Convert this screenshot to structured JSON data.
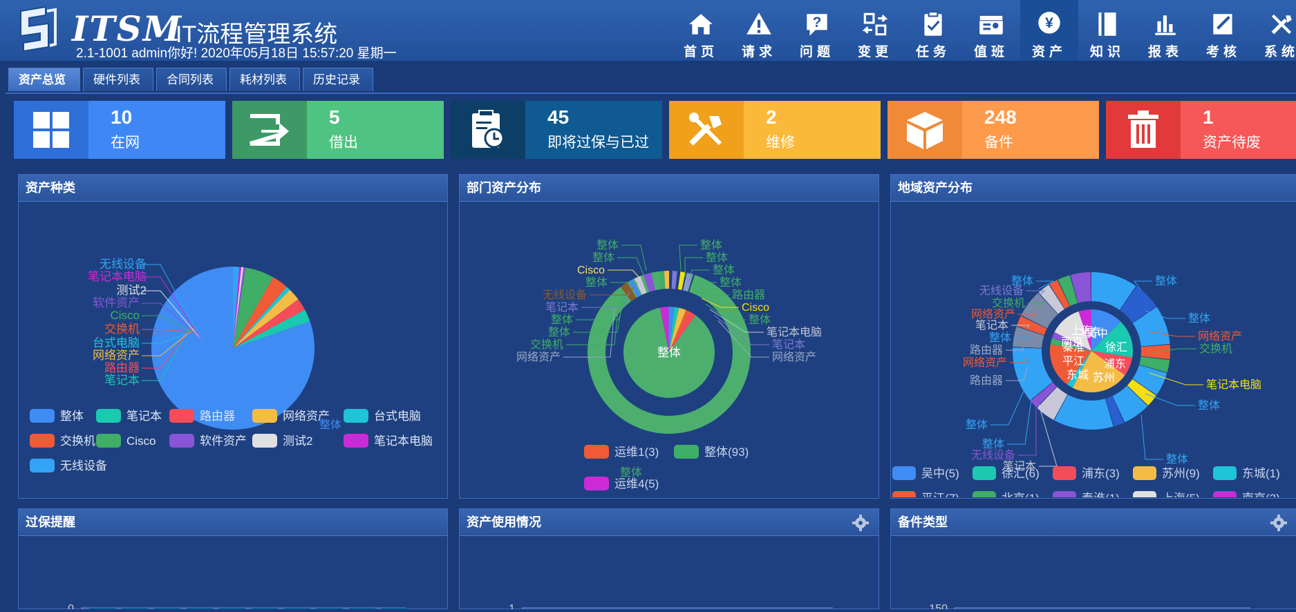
{
  "header": {
    "logo_text": "ITSM",
    "system_title": "IT流程管理系统",
    "user_info": "2.1-1001 admin你好!  2020年05月18日 15:57:20 星期一"
  },
  "nav": [
    {
      "label": "首页",
      "icon": "home-icon"
    },
    {
      "label": "请求",
      "icon": "warning-icon"
    },
    {
      "label": "问题",
      "icon": "question-icon"
    },
    {
      "label": "变更",
      "icon": "swap-icon"
    },
    {
      "label": "任务",
      "icon": "task-icon"
    },
    {
      "label": "值班",
      "icon": "duty-icon"
    },
    {
      "label": "资产",
      "icon": "yen-icon",
      "active": true
    },
    {
      "label": "知识",
      "icon": "book-icon"
    },
    {
      "label": "报表",
      "icon": "chart-icon"
    },
    {
      "label": "考核",
      "icon": "edit-icon"
    },
    {
      "label": "系统",
      "icon": "tools-icon"
    }
  ],
  "tabs": [
    "资产总览",
    "硬件列表",
    "合同列表",
    "耗材列表",
    "历史记录"
  ],
  "stats": [
    {
      "value": "10",
      "label": "在网",
      "icon": "grid-icon",
      "icon_bg": "#2f6fd8",
      "bg": "#3f87f5"
    },
    {
      "value": "5",
      "label": "借出",
      "icon": "export-icon",
      "icon_bg": "#3d9a66",
      "bg": "#4fc381"
    },
    {
      "value": "45",
      "label": "即将过保与已过",
      "icon": "clipboard-clock-icon",
      "icon_bg": "#0d3f66",
      "bg": "#0f5a92"
    },
    {
      "value": "2",
      "label": "维修",
      "icon": "tools-icon",
      "icon_bg": "#f0a01a",
      "bg": "#fbb93a"
    },
    {
      "value": "248",
      "label": "备件",
      "icon": "box-icon",
      "icon_bg": "#f08a36",
      "bg": "#fd9a4c"
    },
    {
      "value": "1",
      "label": "资产待废",
      "icon": "trash-icon",
      "icon_bg": "#e23a3a",
      "bg": "#f65757"
    }
  ],
  "panels": {
    "asset_types": "资产种类",
    "dept_dist": "部门资产分布",
    "region_dist": "地域资产分布",
    "warranty": "过保提醒",
    "usage": "资产使用情况",
    "spare_types": "备件类型"
  },
  "chart_data": [
    {
      "type": "pie",
      "title": "资产种类",
      "categories": [
        "整体",
        "笔记本",
        "路由器",
        "网络资产",
        "台式电脑",
        "交换机",
        "Cisco",
        "软件资产",
        "测试2",
        "笔记本电脑",
        "无线设备"
      ],
      "values": [
        196,
        6,
        6,
        6,
        2,
        8,
        14,
        1,
        1,
        1,
        3
      ],
      "colors": [
        "#3f8cf5",
        "#1bc8b0",
        "#f54c5a",
        "#f4bc45",
        "#1ec4d8",
        "#f05a37",
        "#3fae66",
        "#8a54d6",
        "#e0e0e0",
        "#cc2ad6",
        "#33a4f5"
      ],
      "slice_labels": [
        "整体",
        "笔记本",
        "路由器",
        "网络资产",
        "台式电脑",
        "交换机",
        "Cisco",
        "软件资产",
        "测试2",
        "笔记本电脑",
        "无线设备"
      ]
    },
    {
      "type": "pie",
      "title": "部门资产分布",
      "legend": [
        "运维1(3)",
        "整体(93)",
        "运维4(5)"
      ],
      "legend_colors": [
        "#f05a37",
        "#3fae66",
        "#cc2ad6"
      ],
      "inner": {
        "categories": [
          "整体"
        ],
        "values": [
          93
        ]
      },
      "outer_labels_left": [
        "整体",
        "整体",
        "Cisco",
        "整体",
        "无线设备",
        "笔记本",
        "整体",
        "整体",
        "交换机",
        "网络资产"
      ],
      "outer_labels_right": [
        "整体",
        "整体",
        "整体",
        "整体",
        "路由器",
        "Cisco",
        "整体",
        "笔记本电脑",
        "笔记本",
        "网络资产"
      ],
      "bottom_label": "整体"
    },
    {
      "type": "pie",
      "title": "地域资产分布",
      "legend": [
        "吴中(5)",
        "徐汇(6)",
        "浦东(3)",
        "苏州(9)",
        "东城(1)",
        "平江(7)",
        "北京(1)",
        "秦淮(1)",
        "上海(5)",
        "南京(2)"
      ],
      "legend_colors": [
        "#3f8cf5",
        "#1bc8b0",
        "#f54c5a",
        "#f4bc45",
        "#1ec4d8",
        "#f05a37",
        "#3fae66",
        "#8a54d6",
        "#e0e0e0",
        "#cc2ad6"
      ],
      "inner_labels": [
        "吴中",
        "徐汇",
        "浦东",
        "苏州",
        "东城",
        "平江",
        "秦淮",
        "上海",
        "南京",
        "北京"
      ],
      "outer_labels_left": [
        "整体",
        "无线设备",
        "交换机",
        "网络资产",
        "笔记本",
        "整体",
        "路由器",
        "网络资产",
        "路由器",
        "整体",
        "整体",
        "无线设备",
        "笔记本"
      ],
      "outer_labels_right": [
        "整体",
        "整体",
        "网络资产",
        "交换机",
        "笔记本电脑",
        "整体",
        "整体"
      ]
    },
    {
      "type": "bar",
      "title": "过保提醒",
      "ylim": [
        0,
        0
      ],
      "tick_labels": [
        "0"
      ],
      "bar_count": 10
    },
    {
      "type": "line",
      "title": "资产使用情况",
      "tick_labels": [
        "1"
      ]
    },
    {
      "type": "bar",
      "title": "备件类型",
      "tick_labels": [
        "150"
      ]
    }
  ]
}
